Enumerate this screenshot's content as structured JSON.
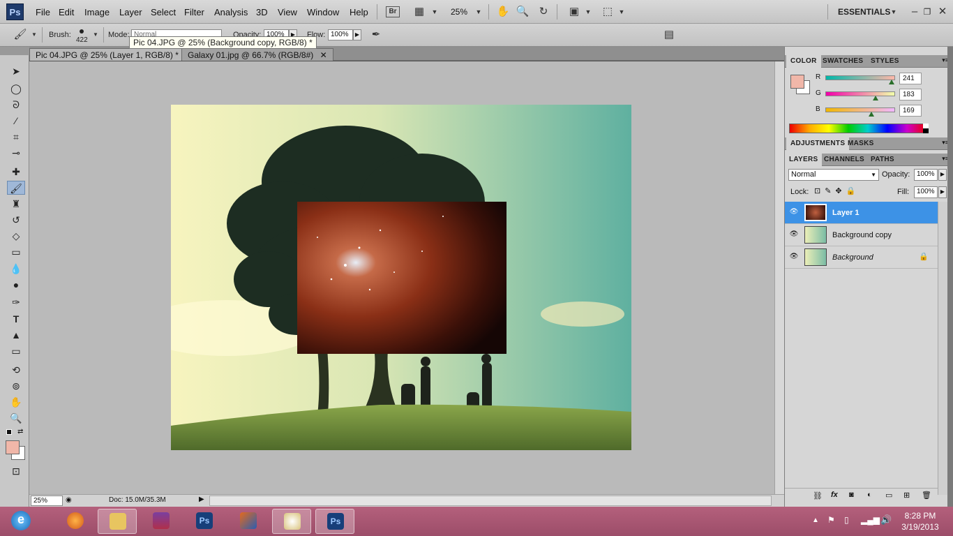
{
  "app": {
    "logo": "Ps"
  },
  "menubar": {
    "items": [
      "File",
      "Edit",
      "Image",
      "Layer",
      "Select",
      "Filter",
      "Analysis",
      "3D",
      "View",
      "Window",
      "Help"
    ],
    "zoom": "25%",
    "bridge": "Br",
    "workspace": "ESSENTIALS"
  },
  "options": {
    "brush_label": "Brush:",
    "brush_size": "422",
    "mode_label": "Mode:",
    "mode_value": "Normal",
    "opacity_label": "Opacity:",
    "opacity_value": "100%",
    "flow_label": "Flow:",
    "flow_value": "100%"
  },
  "tooltip": "Pic 04.JPG @ 25% (Background copy, RGB/8) *",
  "tabs": [
    {
      "label": "Pic 04.JPG @ 25% (Layer 1, RGB/8) *",
      "active": true
    },
    {
      "label": "Galaxy 01.jpg @ 66.7% (RGB/8#)",
      "active": false
    }
  ],
  "status": {
    "zoom": "25%",
    "doc": "Doc: 15.0M/35.3M"
  },
  "color_panel": {
    "tabs": [
      "COLOR",
      "SWATCHES",
      "STYLES"
    ],
    "foreground": "#f1b7a9",
    "channels": [
      {
        "label": "R",
        "value": "241",
        "fraction": 0.945
      },
      {
        "label": "G",
        "value": "183",
        "fraction": 0.718
      },
      {
        "label": "B",
        "value": "169",
        "fraction": 0.663
      }
    ]
  },
  "adjustments_panel": {
    "tabs": [
      "ADJUSTMENTS",
      "MASKS"
    ]
  },
  "layers_panel": {
    "tabs": [
      "LAYERS",
      "CHANNELS",
      "PATHS"
    ],
    "blend_mode": "Normal",
    "opacity_label": "Opacity:",
    "opacity_value": "100%",
    "lock_label": "Lock:",
    "fill_label": "Fill:",
    "fill_value": "100%",
    "layers": [
      {
        "name": "Layer 1",
        "selected": true
      },
      {
        "name": "Background copy",
        "selected": false
      },
      {
        "name": "Background",
        "selected": false,
        "locked": true
      }
    ]
  },
  "taskbar": {
    "apps": [
      "internet-explorer",
      "firefox",
      "file-explorer",
      "winrar",
      "photoshop",
      "matlab",
      "paint",
      "photoshop-active"
    ],
    "time": "8:28 PM",
    "date": "3/19/2013"
  }
}
